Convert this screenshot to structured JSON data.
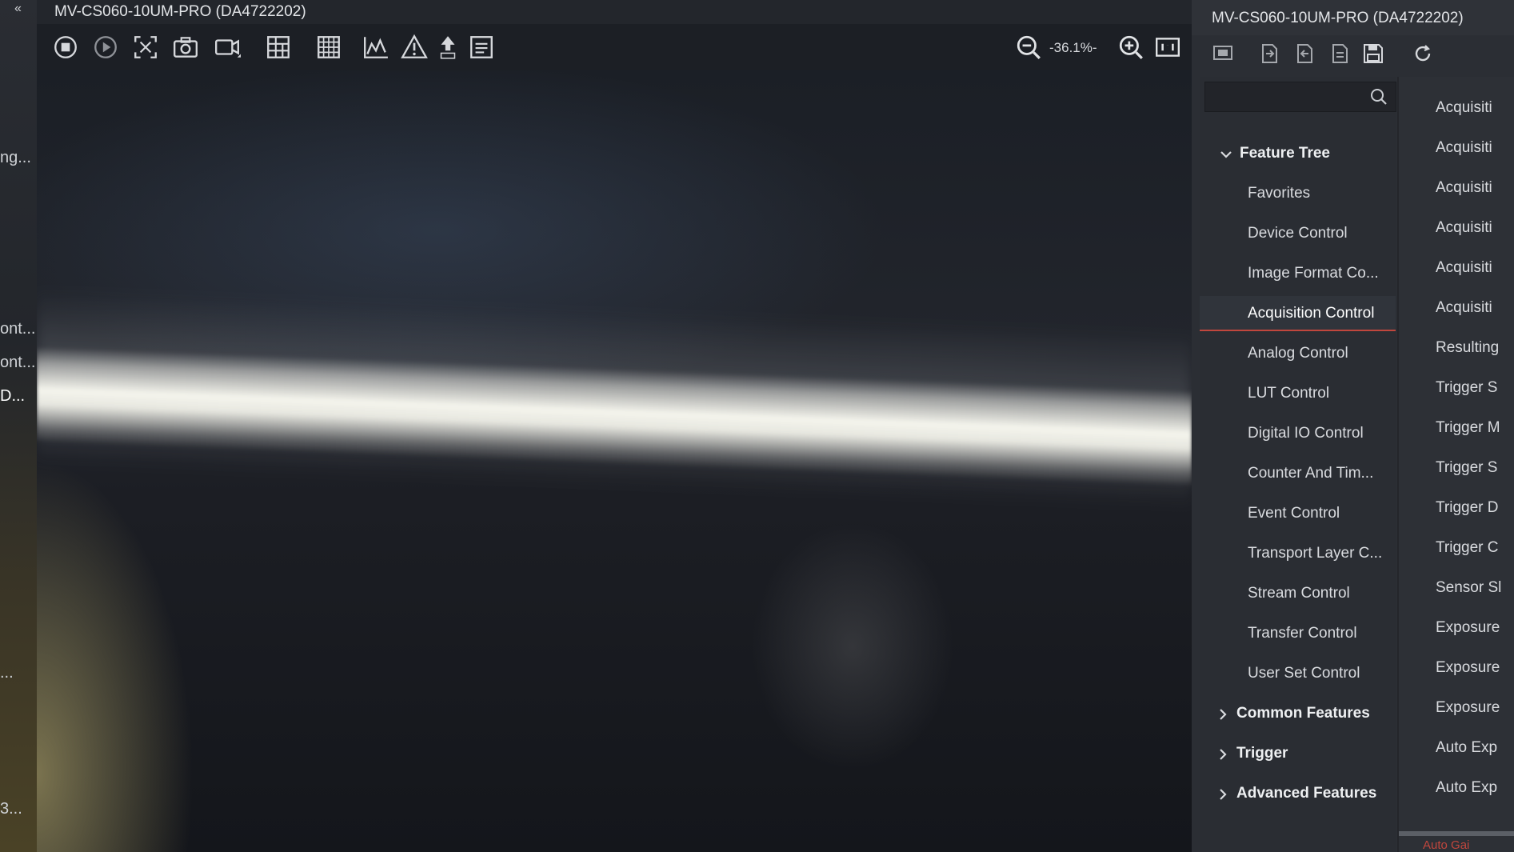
{
  "left_strip": {
    "items": [
      "ng...",
      "ont...",
      "ont...",
      "D...",
      "...",
      "3..."
    ],
    "top_button": "«"
  },
  "viewer": {
    "title": "MV-CS060-10UM-PRO (DA4722202)",
    "zoom": "-36.1%-",
    "toolbar_icons": [
      "stop-icon",
      "play-icon",
      "fit-screen-icon",
      "camera-icon",
      "video-icon",
      "table-icon",
      "grid-icon",
      "histogram-icon",
      "warning-icon",
      "rgb-upload-icon",
      "properties-icon"
    ]
  },
  "right_panel": {
    "title": "MV-CS060-10UM-PRO (DA4722202)",
    "toolbar_icons": [
      "device-icon",
      "import-icon",
      "export-icon",
      "file-icon",
      "save-icon",
      "refresh-icon"
    ],
    "search": {
      "placeholder": ""
    },
    "tree": {
      "root": "Feature Tree",
      "children": [
        "Favorites",
        "Device Control",
        "Image Format Co...",
        "Acquisition Control",
        "Analog Control",
        "LUT Control",
        "Digital IO Control",
        "Counter And Tim...",
        "Event Control",
        "Transport Layer C...",
        "Stream Control",
        "Transfer Control",
        "User Set Control"
      ],
      "selected": "Acquisition Control",
      "groups": [
        "Common Features",
        "Trigger",
        "Advanced Features"
      ]
    },
    "properties": [
      "Acquisiti",
      "Acquisiti",
      "Acquisiti",
      "Acquisiti",
      "Acquisiti",
      "Acquisiti",
      "Resulting",
      "Trigger S",
      "Trigger M",
      "Trigger S",
      "Trigger D",
      "Trigger C",
      "Sensor Sl",
      "Exposure",
      "Exposure",
      "Exposure",
      "Auto Exp",
      "Auto Exp"
    ],
    "bottom_red": "Auto Gai"
  },
  "colors": {
    "accent_red": "#c0463d",
    "panel_bg": "#2b2e34",
    "viewer_bg": "#181b21"
  }
}
